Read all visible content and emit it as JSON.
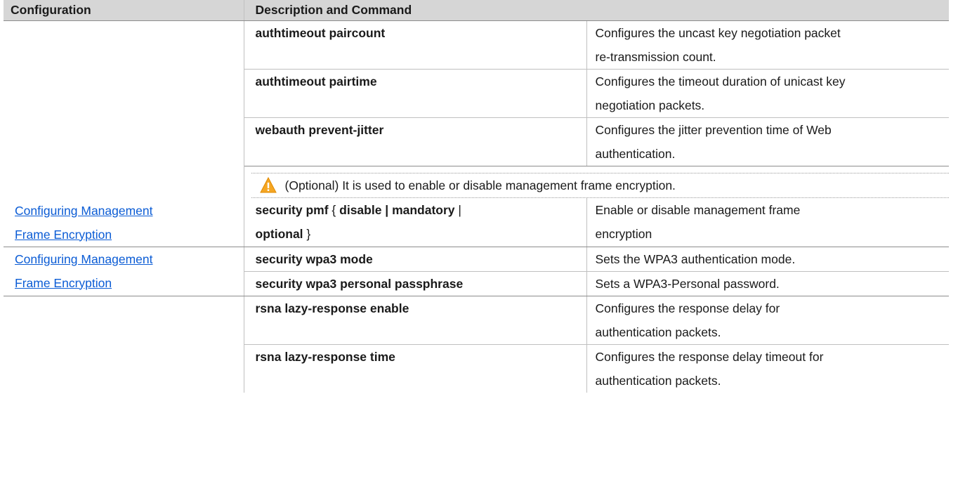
{
  "headers": {
    "configuration": "Configuration",
    "description_command": "Description and Command"
  },
  "rows": [
    {
      "command": "authtimeout paircount",
      "description": [
        "Configures the uncast key negotiation packet",
        "re-transmission count."
      ]
    },
    {
      "command": "authtimeout pairtime",
      "description": [
        "Configures the timeout duration of unicast key",
        "negotiation packets."
      ]
    },
    {
      "command": "webauth prevent-jitter",
      "description": [
        "Configures the jitter prevention time of Web",
        "authentication."
      ]
    }
  ],
  "pmf_section": {
    "config_link": [
      "Configuring Management ",
      "Frame Encryption"
    ],
    "note": "(Optional) It is used to enable or disable management frame encryption.",
    "command_parts": {
      "c1": "security pmf",
      "p1": " { ",
      "c2": "disable | mandatory",
      "p2": " |",
      "c3": "optional",
      "p3": " }"
    },
    "description": [
      "Enable or disable management frame",
      "encryption"
    ]
  },
  "wpa3_section": {
    "config_link": [
      "Configuring Management ",
      "Frame Encryption"
    ],
    "rows": [
      {
        "command": "security wpa3 mode",
        "description": "Sets the WPA3 authentication mode."
      },
      {
        "command": "security wpa3 personal passphrase",
        "description": "Sets a WPA3-Personal password."
      }
    ]
  },
  "rsna_rows": [
    {
      "command": "rsna lazy-response enable",
      "description": [
        "Configures the response delay for",
        "authentication packets."
      ]
    },
    {
      "command": "rsna lazy-response time",
      "description": [
        "Configures the response delay timeout for",
        "authentication packets."
      ]
    }
  ],
  "icons": {
    "note": "warning-icon"
  },
  "colors": {
    "header_bg": "#d6d6d6",
    "link": "#0b5cd5",
    "warning": "#f5a623"
  }
}
